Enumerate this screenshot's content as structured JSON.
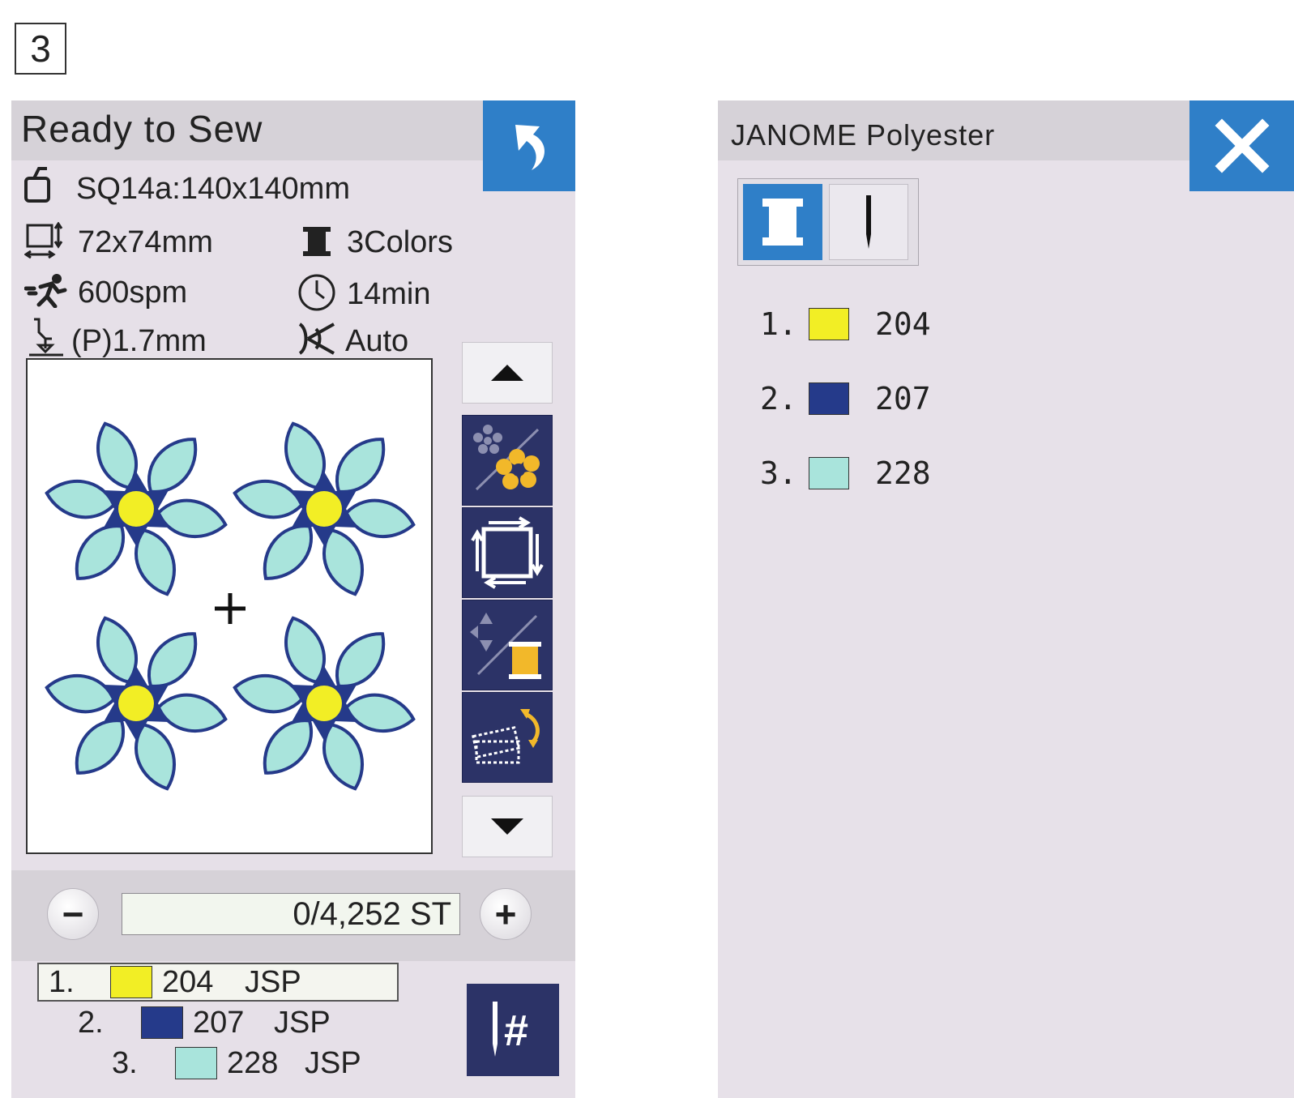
{
  "step_number": "3",
  "left_panel": {
    "title": "Ready to Sew",
    "hoop": "SQ14a:140x140mm",
    "size": "72x74mm",
    "colors": "3Colors",
    "speed": "600spm",
    "time": "14min",
    "foot_height": "(P)1.7mm",
    "thread_trim": "Auto",
    "stitch_counter": "0/4,252 ST",
    "minus_label": "−",
    "plus_label": "+",
    "needle_button_label": "#",
    "threads": [
      {
        "num": "1.",
        "code": "204",
        "brand": "JSP",
        "color": "#f2ee25"
      },
      {
        "num": "2.",
        "code": "207",
        "brand": "JSP",
        "color": "#253a8a"
      },
      {
        "num": "3.",
        "code": "228",
        "brand": "JSP",
        "color": "#a9e4dc"
      }
    ]
  },
  "right_panel": {
    "title": "JANOME Polyester",
    "list": [
      {
        "num": "1.",
        "code": "204",
        "color": "#f2ee25"
      },
      {
        "num": "2.",
        "code": "207",
        "color": "#253a8a"
      },
      {
        "num": "3.",
        "code": "228",
        "color": "#a9e4dc"
      }
    ]
  },
  "colors": {
    "accent_blue": "#2f7fc8",
    "tool_navy": "#2c3367",
    "panel_bg": "#e6e0e8",
    "flower_center": "#f2ee25",
    "flower_dark": "#253a8a",
    "flower_light": "#a9e4dc"
  },
  "icons": [
    "back-arrow-icon",
    "hoop-icon",
    "size-icon",
    "spool-icon",
    "runner-icon",
    "clock-icon",
    "presser-foot-icon",
    "scissors-icon",
    "arrow-up-icon",
    "arrow-down-icon",
    "design-edit-icon",
    "trace-icon",
    "thread-color-icon",
    "rotate-design-icon",
    "needle-number-icon",
    "close-icon",
    "spool-mode-icon",
    "needle-mode-icon"
  ]
}
